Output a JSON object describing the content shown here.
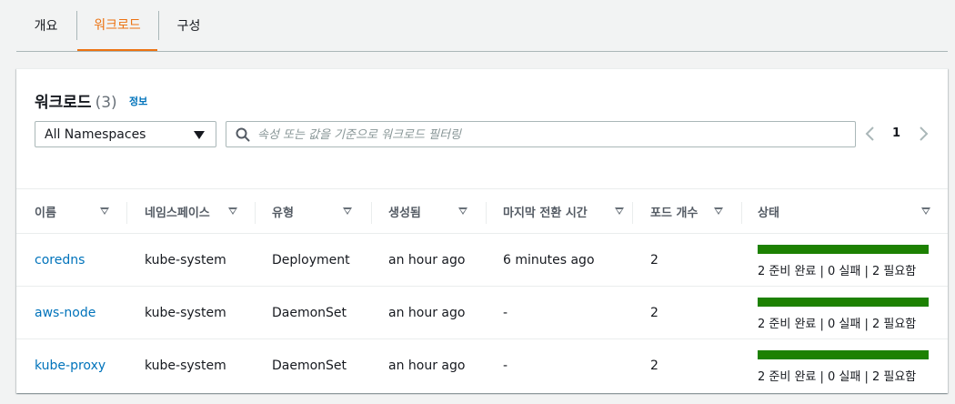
{
  "tabs": [
    {
      "label": "개요",
      "active": false
    },
    {
      "label": "워크로드",
      "active": true
    },
    {
      "label": "구성",
      "active": false
    }
  ],
  "panel": {
    "title": "워크로드",
    "count": "(3)",
    "info_link": "정보"
  },
  "namespace_select": {
    "value": "All Namespaces"
  },
  "filter": {
    "placeholder": "속성 또는 값을 기준으로 워크로드 필터링",
    "value": ""
  },
  "pagination": {
    "current_page": "1"
  },
  "columns": [
    "이름",
    "네임스페이스",
    "유형",
    "생성됨",
    "마지막 전환 시간",
    "포드 개수",
    "상태"
  ],
  "rows": [
    {
      "name": "coredns",
      "namespace": "kube-system",
      "type": "Deployment",
      "created": "an hour ago",
      "last_transition": "6 minutes ago",
      "pod_count": "2",
      "status_text": "2 준비 완료 | 0 실패 | 2 필요함",
      "ready_fraction": 1.0
    },
    {
      "name": "aws-node",
      "namespace": "kube-system",
      "type": "DaemonSet",
      "created": "an hour ago",
      "last_transition": "-",
      "pod_count": "2",
      "status_text": "2 준비 완료 | 0 실패 | 2 필요함",
      "ready_fraction": 1.0
    },
    {
      "name": "kube-proxy",
      "namespace": "kube-system",
      "type": "DaemonSet",
      "created": "an hour ago",
      "last_transition": "-",
      "pod_count": "2",
      "status_text": "2 준비 완료 | 0 실패 | 2 필요함",
      "ready_fraction": 1.0
    }
  ],
  "colors": {
    "active_tab": "#ec7211",
    "link": "#0073bb",
    "status_ready": "#1d8102"
  },
  "icons": {
    "search": "search-icon",
    "prev": "chevron-left-icon",
    "next": "chevron-right-icon",
    "sort": "sort-caret-icon",
    "select": "caret-down-icon"
  }
}
